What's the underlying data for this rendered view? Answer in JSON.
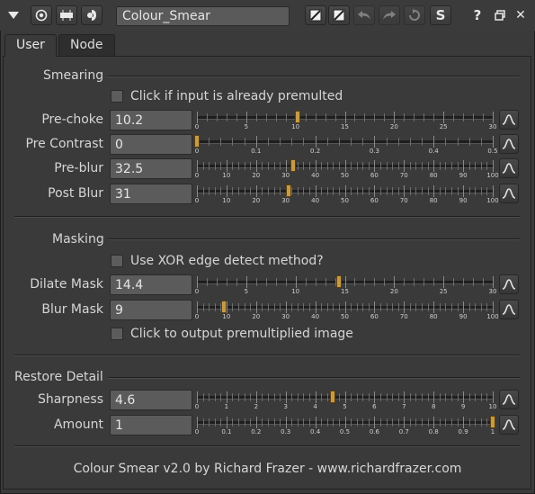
{
  "toolbar": {
    "node_name": "Colour_Smear",
    "buttons": [
      {
        "name": "collapse-arrow-icon"
      },
      {
        "name": "view-node-icon"
      },
      {
        "name": "node-color-icon"
      },
      {
        "name": "settings-icon"
      },
      {
        "name": "disable-icon"
      },
      {
        "name": "disable-alt-icon"
      },
      {
        "name": "undo-icon"
      },
      {
        "name": "redo-icon"
      },
      {
        "name": "revert-icon"
      },
      {
        "name": "script-icon"
      },
      {
        "name": "help-icon"
      },
      {
        "name": "float-panel-icon"
      },
      {
        "name": "close-icon"
      }
    ],
    "s_label": "S",
    "help_label": "?",
    "close_label": "✕"
  },
  "tabs": [
    "User",
    "Node"
  ],
  "sections": {
    "smearing": {
      "title": "Smearing",
      "checkbox": "Click if input is already premulted",
      "knobs": [
        {
          "label": "Pre-choke",
          "value": "10.2",
          "min": 0,
          "max": 30,
          "ticks": [
            "0",
            "5",
            "10",
            "15",
            "20",
            "25",
            "30"
          ]
        },
        {
          "label": "Pre Contrast",
          "value": "0",
          "min": 0,
          "max": 0.5,
          "ticks": [
            "0",
            "0.1",
            "0.2",
            "0.3",
            "0.4",
            "0.5"
          ]
        },
        {
          "label": "Pre-blur",
          "value": "32.5",
          "min": 0,
          "max": 100,
          "ticks": [
            "0",
            "10",
            "20",
            "30",
            "40",
            "50",
            "60",
            "70",
            "80",
            "90",
            "100"
          ]
        },
        {
          "label": "Post Blur",
          "value": "31",
          "min": 0,
          "max": 100,
          "ticks": [
            "0",
            "10",
            "20",
            "30",
            "40",
            "50",
            "60",
            "70",
            "80",
            "90",
            "100"
          ]
        }
      ]
    },
    "masking": {
      "title": "Masking",
      "checkbox": "Use XOR edge detect method?",
      "knobs": [
        {
          "label": "Dilate Mask",
          "value": "14.4",
          "min": 0,
          "max": 30,
          "ticks": [
            "0",
            "5",
            "10",
            "15",
            "20",
            "25",
            "30"
          ]
        },
        {
          "label": "Blur Mask",
          "value": "9",
          "min": 0,
          "max": 100,
          "ticks": [
            "0",
            "10",
            "20",
            "30",
            "40",
            "50",
            "60",
            "70",
            "80",
            "90",
            "100"
          ]
        }
      ],
      "checkbox2": "Click to output premultiplied image"
    },
    "restore": {
      "title": "Restore Detail",
      "knobs": [
        {
          "label": "Sharpness",
          "value": "4.6",
          "min": 0,
          "max": 10,
          "ticks": [
            "0",
            "1",
            "2",
            "3",
            "4",
            "5",
            "6",
            "7",
            "8",
            "9",
            "10"
          ]
        },
        {
          "label": "Amount",
          "value": "1",
          "min": 0,
          "max": 1,
          "ticks": [
            "0",
            "0.1",
            "0.2",
            "0.3",
            "0.4",
            "0.5",
            "0.6",
            "0.7",
            "0.8",
            "0.9",
            "1"
          ]
        }
      ]
    }
  },
  "footer": "Colour Smear v2.0 by Richard Frazer - www.richardfrazer.com",
  "colors": {
    "handle": "#c69b45",
    "background": "#3a3a3a",
    "field": "#5b5b5b"
  }
}
